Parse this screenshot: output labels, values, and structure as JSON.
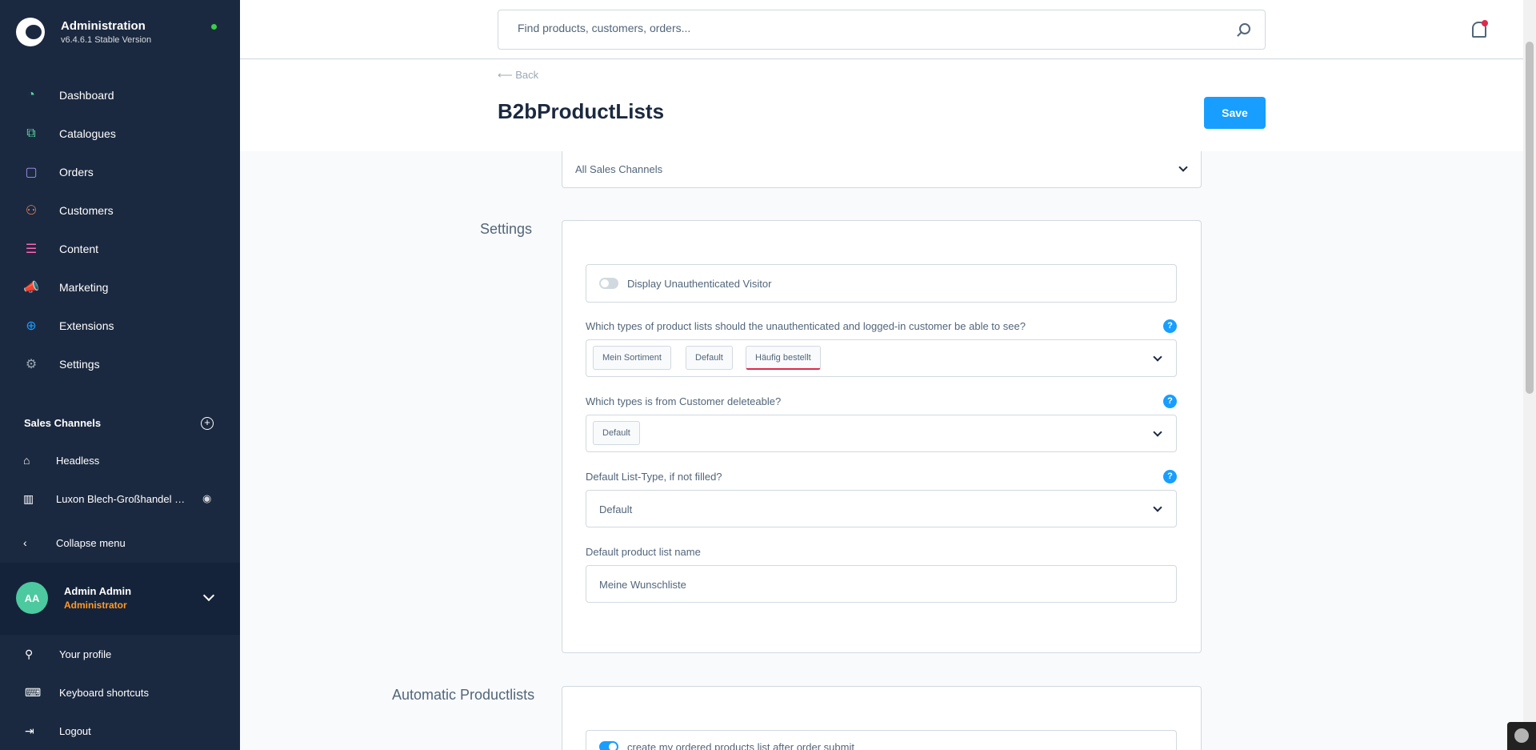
{
  "app": {
    "title": "Administration",
    "version": "v6.4.6.1 Stable Version",
    "status_color": "#37d046"
  },
  "nav": [
    {
      "label": "Dashboard",
      "icon": "dashboard-icon",
      "color": "#57d9a3"
    },
    {
      "label": "Catalogues",
      "icon": "catalogue-icon",
      "color": "#57d9a3"
    },
    {
      "label": "Orders",
      "icon": "orders-icon",
      "color": "#a092f0"
    },
    {
      "label": "Customers",
      "icon": "customers-icon",
      "color": "#f88962"
    },
    {
      "label": "Content",
      "icon": "content-icon",
      "color": "#ff68b4"
    },
    {
      "label": "Marketing",
      "icon": "marketing-icon",
      "color": "#ffd700"
    },
    {
      "label": "Extensions",
      "icon": "extensions-icon",
      "color": "#189eff"
    },
    {
      "label": "Settings",
      "icon": "settings-icon",
      "color": "#9aa8b5"
    }
  ],
  "sales_channels": {
    "title": "Sales Channels",
    "items": [
      {
        "label": "Headless",
        "icon": "basket-icon"
      },
      {
        "label": "Luxon Blech-Großhandel GmbH",
        "icon": "storefront-icon"
      }
    ],
    "collapse_label": "Collapse menu"
  },
  "user": {
    "initials": "AA",
    "name": "Admin Admin",
    "role": "Administrator"
  },
  "user_menu": [
    {
      "label": "Your profile",
      "icon": "profile-icon"
    },
    {
      "label": "Keyboard shortcuts",
      "icon": "keyboard-icon"
    },
    {
      "label": "Logout",
      "icon": "logout-icon"
    }
  ],
  "search": {
    "placeholder": "Find products, customers, orders..."
  },
  "page": {
    "back_label": "Back",
    "title": "B2bProductLists",
    "save_label": "Save"
  },
  "channel_select": {
    "value": "All Sales Channels"
  },
  "settings": {
    "section_title": "Settings",
    "toggle_label": "Display Unauthenticated Visitor",
    "list_types_label": "Which types of product lists should the unauthenticated and logged-in customer be able to see?",
    "list_types_tags": [
      "Mein Sortiment",
      "Default",
      "Häufig bestellt"
    ],
    "deletable_label": "Which types is from Customer deleteable?",
    "deletable_tags": [
      "Default"
    ],
    "default_type_label": "Default List-Type, if not filled?",
    "default_type_value": "Default",
    "default_name_label": "Default product list name",
    "default_name_value": "Meine Wunschliste"
  },
  "automatic": {
    "section_title": "Automatic Productlists",
    "toggle_label": "create my ordered products list after order submit"
  },
  "help_symbol": "?"
}
